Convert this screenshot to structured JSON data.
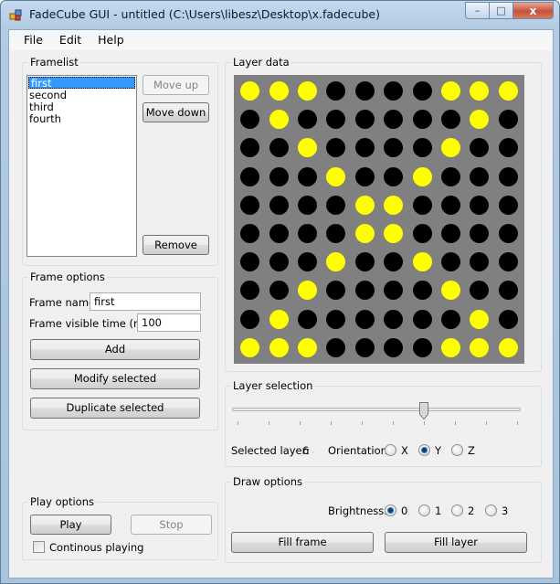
{
  "window": {
    "title": "FadeCube GUI - untitled (C:\\Users\\libesz\\Desktop\\x.fadecube)",
    "min_glyph": "–",
    "max_glyph": "□",
    "close_glyph": "x"
  },
  "menu": [
    "File",
    "Edit",
    "Help"
  ],
  "framelist": {
    "label": "Framelist",
    "items": [
      "first",
      "second",
      "third",
      "fourth"
    ],
    "selected_index": 0,
    "move_up": "Move up",
    "move_down": "Move down",
    "remove": "Remove"
  },
  "frame_options": {
    "label": "Frame options",
    "name_label": "Frame name:",
    "name_value": "first",
    "time_label": "Frame visible time (ms):",
    "time_value": "100",
    "add": "Add",
    "modify": "Modify selected",
    "duplicate": "Duplicate selected"
  },
  "play_options": {
    "label": "Play options",
    "play": "Play",
    "stop": "Stop",
    "continuous_label": "Continous playing",
    "continuous_checked": false
  },
  "layer_data": {
    "label": "Layer data",
    "on_color": "#ffff00",
    "off_color": "#000000",
    "background": "#808080",
    "rows": [
      [
        1,
        1,
        1,
        0,
        0,
        0,
        0,
        1,
        1,
        1
      ],
      [
        0,
        1,
        0,
        0,
        0,
        0,
        0,
        0,
        1,
        0
      ],
      [
        0,
        0,
        1,
        0,
        0,
        0,
        0,
        1,
        0,
        0
      ],
      [
        0,
        0,
        0,
        1,
        0,
        0,
        1,
        0,
        0,
        0
      ],
      [
        0,
        0,
        0,
        0,
        1,
        1,
        0,
        0,
        0,
        0
      ],
      [
        0,
        0,
        0,
        0,
        1,
        1,
        0,
        0,
        0,
        0
      ],
      [
        0,
        0,
        0,
        1,
        0,
        0,
        1,
        0,
        0,
        0
      ],
      [
        0,
        0,
        1,
        0,
        0,
        0,
        0,
        1,
        0,
        0
      ],
      [
        0,
        1,
        0,
        0,
        0,
        0,
        0,
        0,
        1,
        0
      ],
      [
        1,
        1,
        1,
        0,
        0,
        0,
        0,
        1,
        1,
        1
      ]
    ]
  },
  "layer_selection": {
    "label": "Layer selection",
    "slider_min": 0,
    "slider_max": 9,
    "slider_value": 6,
    "selected_label": "Selected layer:",
    "selected_value": "6",
    "orientation_label": "Orientation:",
    "orientations": [
      "X",
      "Y",
      "Z"
    ],
    "orientation_selected": "Y"
  },
  "draw_options": {
    "label": "Draw options",
    "brightness_label": "Brightness:",
    "brightness_levels": [
      "0",
      "1",
      "2",
      "3"
    ],
    "brightness_selected": "0",
    "fill_frame": "Fill frame",
    "fill_layer": "Fill layer"
  }
}
